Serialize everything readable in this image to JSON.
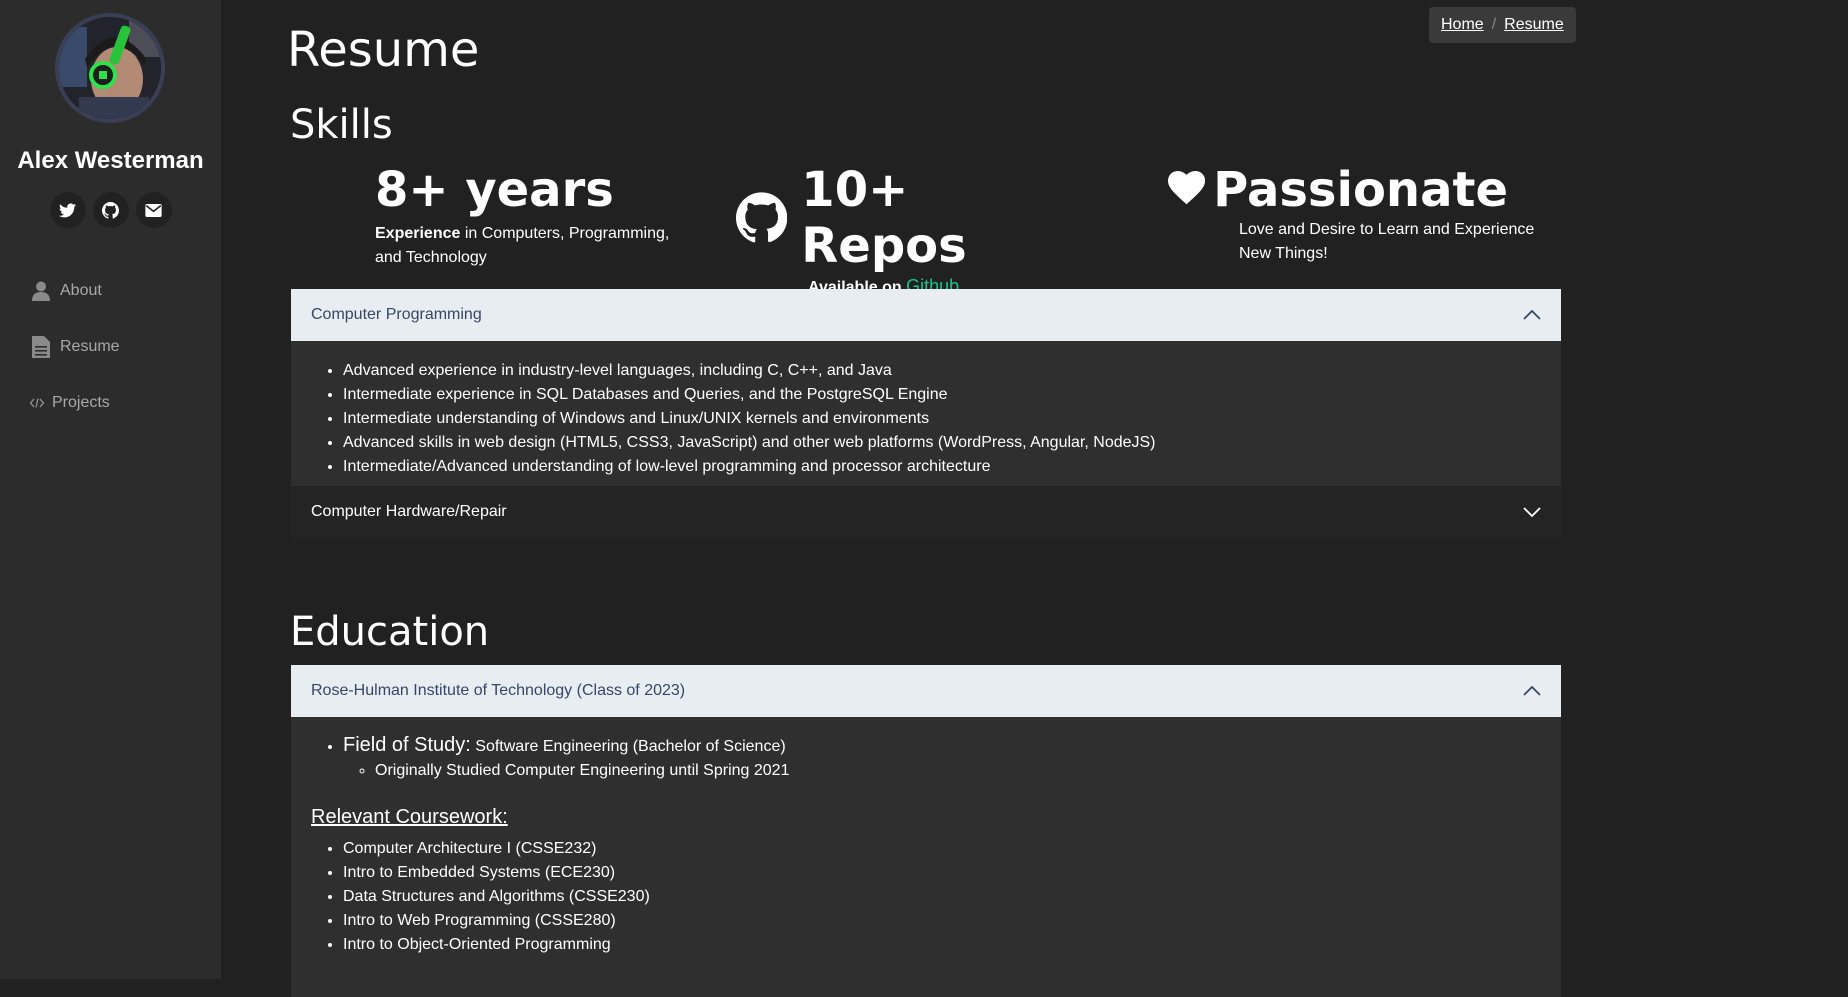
{
  "profile": {
    "name": "Alex Westerman"
  },
  "socials": [
    {
      "icon": "twitter-icon"
    },
    {
      "icon": "github-icon"
    },
    {
      "icon": "mail-icon"
    }
  ],
  "nav": {
    "items": [
      {
        "label": "About",
        "icon": "user-icon"
      },
      {
        "label": "Resume",
        "icon": "document-icon"
      },
      {
        "label": "Projects",
        "icon": "code-icon"
      }
    ]
  },
  "breadcrumb": {
    "home": "Home",
    "separator": "/",
    "current": "Resume"
  },
  "page": {
    "title": "Resume"
  },
  "skills": {
    "title": "Skills",
    "stats": [
      {
        "big": "8+ years",
        "desc_bold": "Experience",
        "desc": " in Computers, Programming, and Technology"
      },
      {
        "big": "10+ Repos",
        "desc_bold": "Available on ",
        "link": "Github",
        "icon": "github-icon"
      },
      {
        "big": "Passionate",
        "desc": "Love and Desire to Learn and Experience New Things!",
        "icon": "heart-icon"
      }
    ],
    "accordion": [
      {
        "title": "Computer Programming",
        "expanded": true,
        "items": [
          "Advanced experience in industry-level languages, including C, C++, and Java",
          "Intermediate experience in SQL Databases and Queries, and the PostgreSQL Engine",
          "Intermediate understanding of Windows and Linux/UNIX kernels and environments",
          "Advanced skills in web design (HTML5, CSS3, JavaScript) and other web platforms (WordPress, Angular, NodeJS)",
          "Intermediate/Advanced understanding of low-level programming and processor architecture"
        ]
      },
      {
        "title": "Computer Hardware/Repair",
        "expanded": false
      }
    ]
  },
  "education": {
    "title": "Education",
    "accordion": {
      "title": "Rose-Hulman Institute of Technology (Class of 2023)",
      "expanded": true,
      "field_label": "Field of Study:",
      "field_value": " Software Engineering (Bachelor of Science)",
      "sub_item": "Originally Studied Computer Engineering until Spring 2021",
      "coursework_title": "Relevant Coursework:",
      "coursework": [
        "Computer Architecture I (CSSE232)",
        "Intro to Embedded Systems (ECE230)",
        "Data Structures and Algorithms (CSSE230)",
        "Intro to Web Programming (CSSE280)",
        "Intro to Object-Oriented Programming"
      ]
    }
  },
  "colors": {
    "accent_link": "#1fc38a",
    "sidebar_bg": "#2c2c2c",
    "page_bg": "#212121",
    "accordion_open": "#e8edf1"
  }
}
